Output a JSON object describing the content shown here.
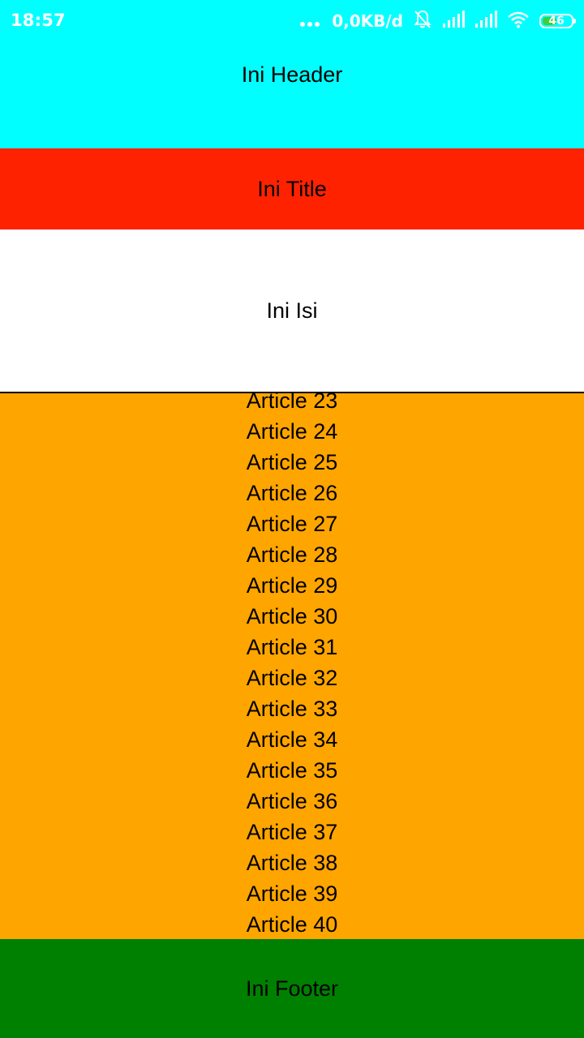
{
  "status_bar": {
    "time": "18:57",
    "network_speed": "0,0KB/d",
    "battery_level": "46",
    "icons": [
      "more-dots-icon",
      "bell-muted-icon",
      "signal-icon",
      "signal-icon",
      "wifi-icon",
      "battery-icon"
    ],
    "battery_color": "#3ad13a"
  },
  "header": {
    "text": "Ini Header",
    "color": "#00ffff"
  },
  "title": {
    "text": "Ini Title",
    "color": "#ff2200"
  },
  "content": {
    "text": "Ini Isi",
    "color": "#ffffff"
  },
  "articles": {
    "color": "#ffa500",
    "items": [
      "Article 23",
      "Article 24",
      "Article 25",
      "Article 26",
      "Article 27",
      "Article 28",
      "Article 29",
      "Article 30",
      "Article 31",
      "Article 32",
      "Article 33",
      "Article 34",
      "Article 35",
      "Article 36",
      "Article 37",
      "Article 38",
      "Article 39",
      "Article 40"
    ]
  },
  "footer": {
    "text": "Ini Footer",
    "color": "#008000"
  }
}
